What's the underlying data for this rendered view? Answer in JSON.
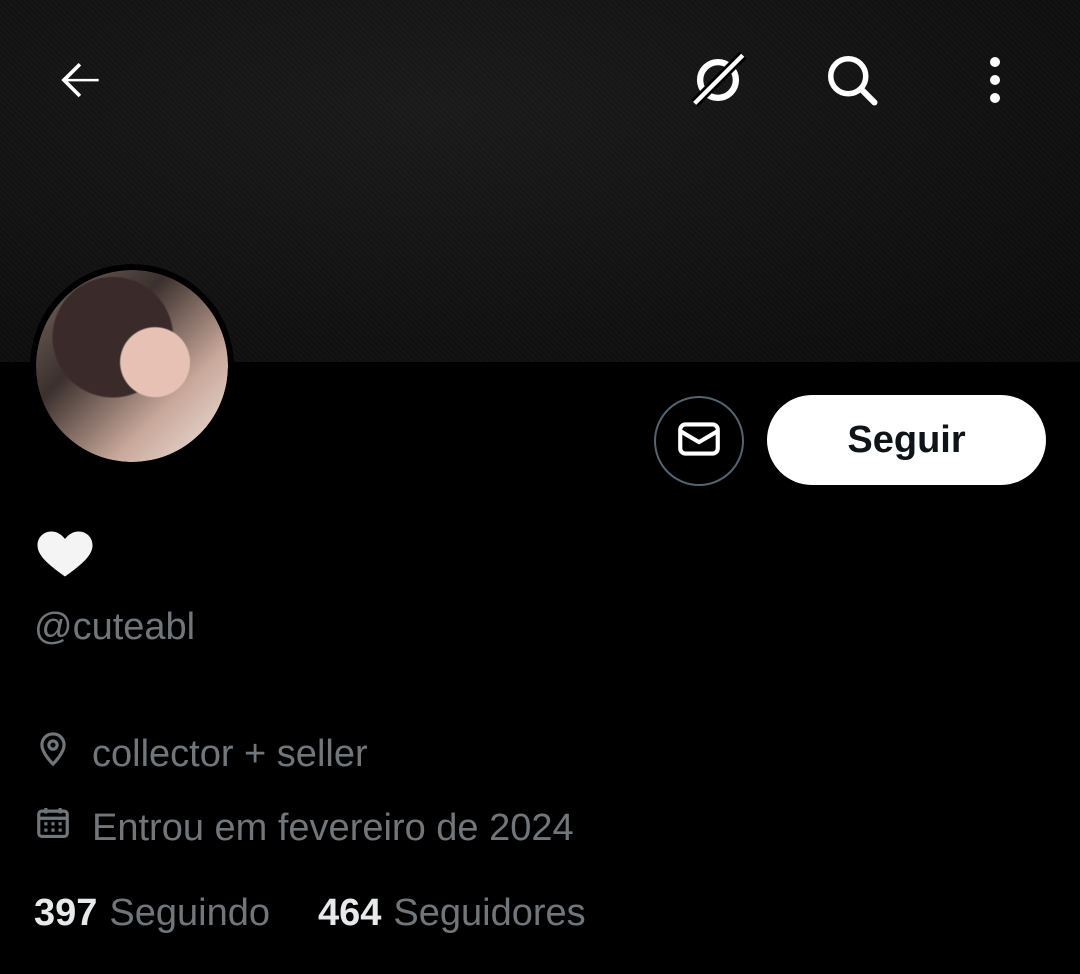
{
  "header": {
    "back_icon": "arrow-left-icon",
    "grok_icon": "grok-icon",
    "search_icon": "search-icon",
    "more_icon": "more-vertical-icon"
  },
  "profile": {
    "display_name_icon": "white-heart-icon",
    "handle": "@cuteabl",
    "location": "collector + seller",
    "joined": "Entrou em fevereiro de 2024"
  },
  "actions": {
    "message_icon": "envelope-icon",
    "follow_label": "Seguir"
  },
  "stats": {
    "following_count": "397",
    "following_label": "Seguindo",
    "followers_count": "464",
    "followers_label": "Seguidores"
  },
  "colors": {
    "background": "#000000",
    "text_primary": "#e7e9ea",
    "text_secondary": "#71767b",
    "border": "#536471",
    "follow_button_bg": "#ffffff"
  }
}
